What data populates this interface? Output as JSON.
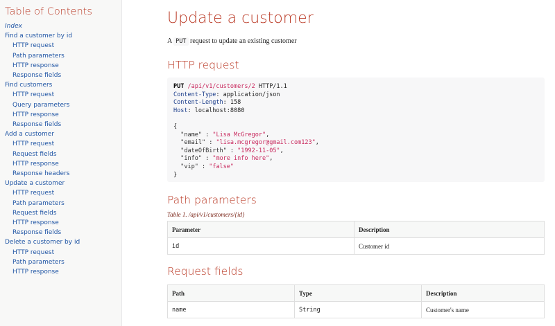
{
  "toc": {
    "title": "Table of Contents",
    "items": [
      {
        "label": "Index",
        "level": 0,
        "italic": true
      },
      {
        "label": "Find a customer by id",
        "level": 0
      },
      {
        "label": "HTTP request",
        "level": 1
      },
      {
        "label": "Path parameters",
        "level": 1
      },
      {
        "label": "HTTP response",
        "level": 1
      },
      {
        "label": "Response fields",
        "level": 1
      },
      {
        "label": "Find customers",
        "level": 0
      },
      {
        "label": "HTTP request",
        "level": 1
      },
      {
        "label": "Query parameters",
        "level": 1
      },
      {
        "label": "HTTP response",
        "level": 1
      },
      {
        "label": "Response fields",
        "level": 1
      },
      {
        "label": "Add a customer",
        "level": 0
      },
      {
        "label": "HTTP request",
        "level": 1
      },
      {
        "label": "Request fields",
        "level": 1
      },
      {
        "label": "HTTP response",
        "level": 1
      },
      {
        "label": "Response headers",
        "level": 1
      },
      {
        "label": "Update a customer",
        "level": 0
      },
      {
        "label": "HTTP request",
        "level": 1
      },
      {
        "label": "Path parameters",
        "level": 1
      },
      {
        "label": "Request fields",
        "level": 1
      },
      {
        "label": "HTTP response",
        "level": 1
      },
      {
        "label": "Response fields",
        "level": 1
      },
      {
        "label": "Delete a customer by id",
        "level": 0
      },
      {
        "label": "HTTP request",
        "level": 1
      },
      {
        "label": "Path parameters",
        "level": 1
      },
      {
        "label": "HTTP response",
        "level": 1
      }
    ]
  },
  "page": {
    "title": "Update a customer",
    "lead_prefix": "A ",
    "lead_code": "PUT",
    "lead_suffix": " request to update an existing customer"
  },
  "http_request": {
    "heading": "HTTP request",
    "method": "PUT",
    "url": "/api/v1/customers/2",
    "protocol": " HTTP/1.1",
    "headers": [
      {
        "name": "Content-Type",
        "value": ": application/json"
      },
      {
        "name": "Content-Length",
        "value": ": 158"
      },
      {
        "name": "Host",
        "value": ": localhost:8080"
      }
    ],
    "body_open": "{",
    "body_fields": [
      {
        "key": "\"name\"",
        "sep": " : ",
        "value": "\"Lisa McGregor\"",
        "trail": ","
      },
      {
        "key": "\"email\"",
        "sep": " : ",
        "value": "\"lisa.mcgregor@gmail.com123\"",
        "trail": ","
      },
      {
        "key": "\"dateOfBirth\"",
        "sep": " : ",
        "value": "\"1992-11-05\"",
        "trail": ","
      },
      {
        "key": "\"info\"",
        "sep": " : ",
        "value": "\"more info here\"",
        "trail": ","
      },
      {
        "key": "\"vip\"",
        "sep": " : ",
        "value": "\"false\"",
        "trail": ""
      }
    ],
    "body_close": "}"
  },
  "path_parameters": {
    "heading": "Path parameters",
    "caption": "Table 1. /api/v1/customers/{id}",
    "columns": [
      "Parameter",
      "Description"
    ],
    "rows": [
      [
        "id",
        "Customer id"
      ]
    ]
  },
  "request_fields": {
    "heading": "Request fields",
    "columns": [
      "Path",
      "Type",
      "Description"
    ],
    "rows": [
      [
        "name",
        "String",
        "Customer's name"
      ]
    ]
  }
}
